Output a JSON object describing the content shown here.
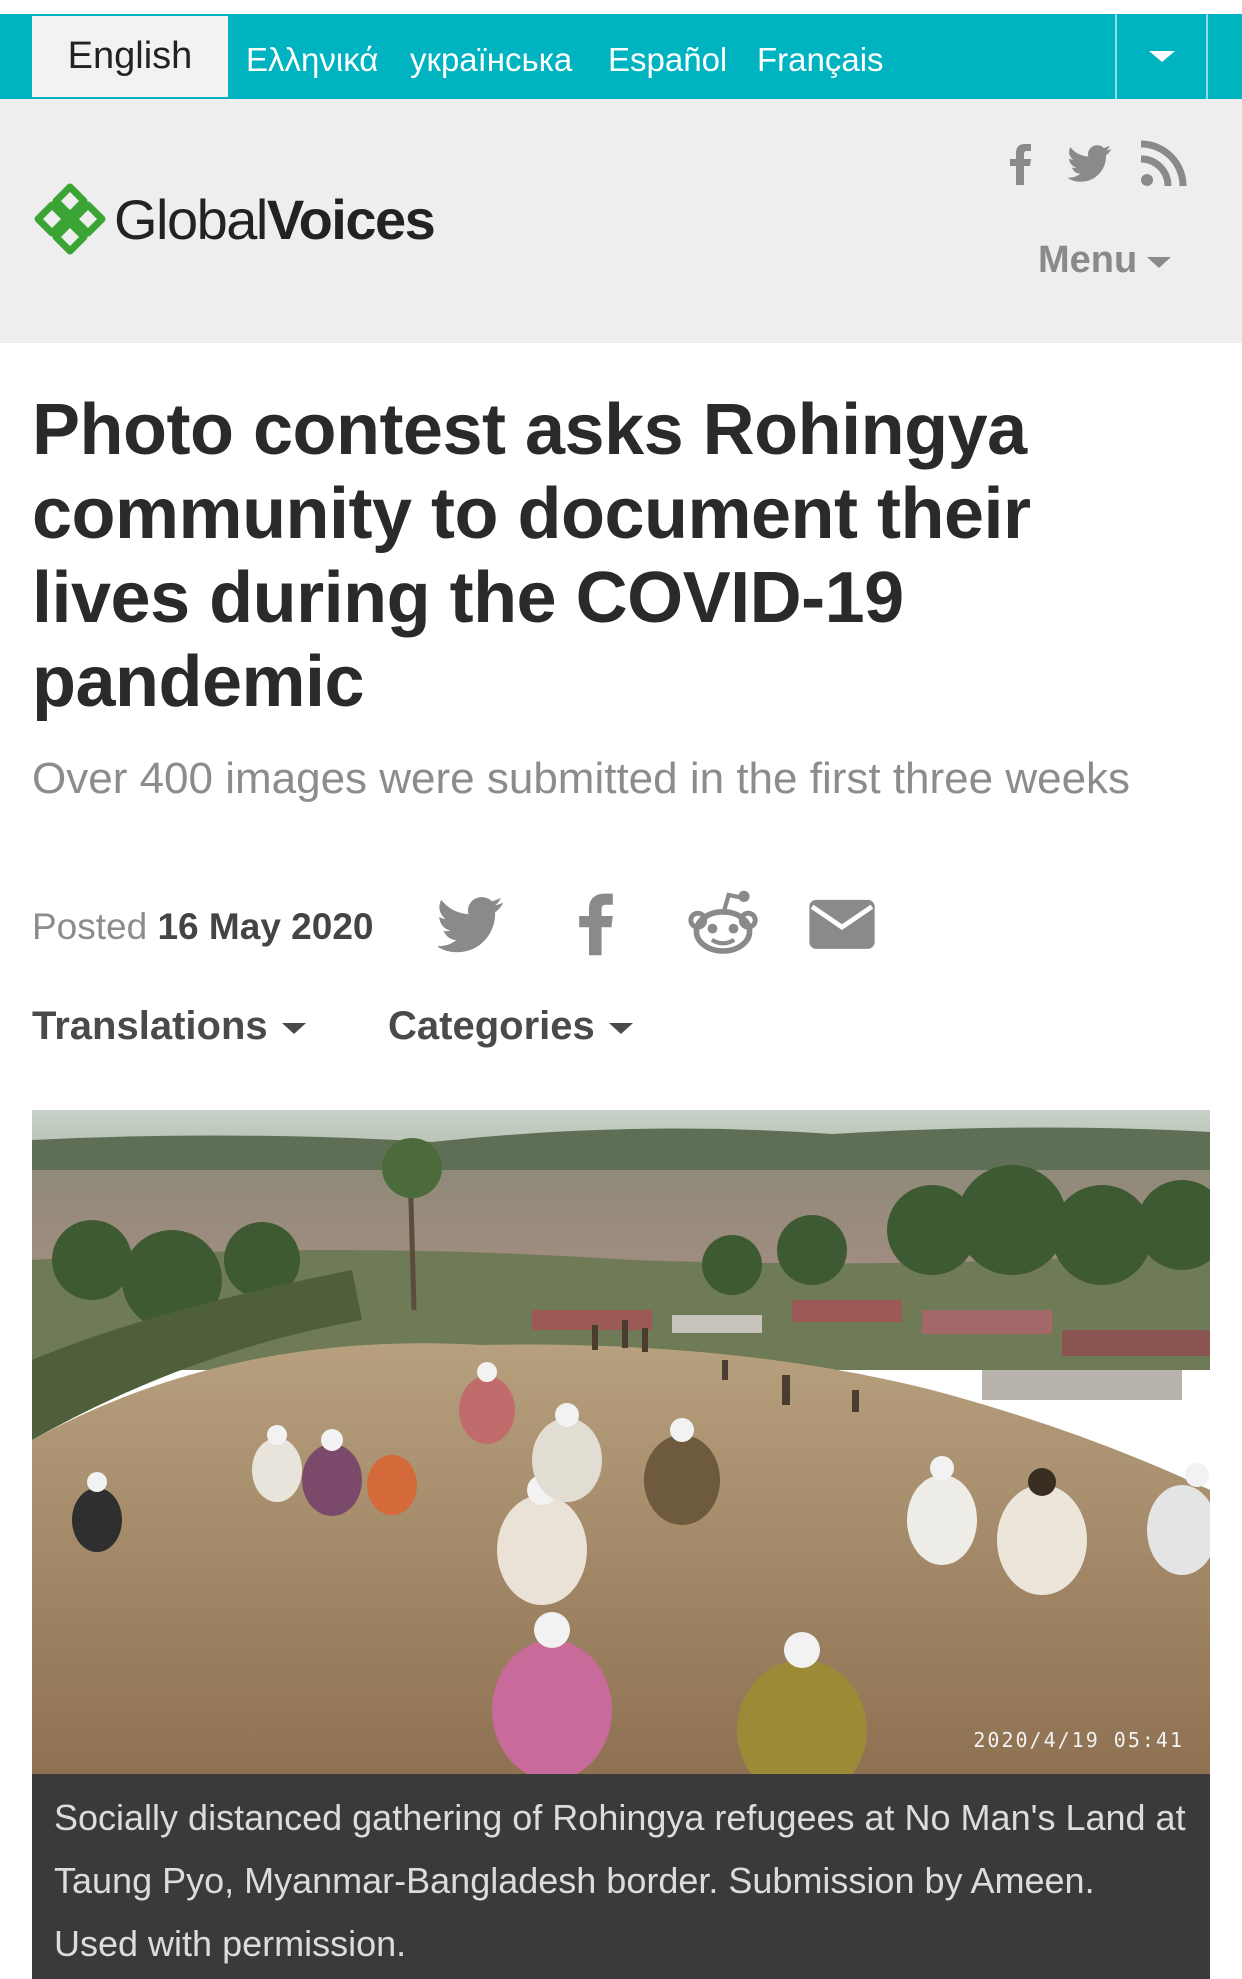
{
  "language_bar": {
    "active": "English",
    "languages": [
      "Ελληνικά",
      "українська",
      "Español",
      "Français"
    ]
  },
  "header": {
    "logo_light": "Global",
    "logo_bold": "Voices",
    "social_icons": [
      "facebook-icon",
      "twitter-icon",
      "rss-icon"
    ],
    "menu_label": "Menu"
  },
  "article": {
    "title": "Photo contest asks Rohingya community to document their lives during the COVID-19 pandemic",
    "subtitle": "Over 400 images were submitted in the first three weeks",
    "posted_label": "Posted",
    "posted_date": "16 May 2020",
    "share_icons": [
      "twitter-icon",
      "facebook-icon",
      "reddit-icon",
      "email-icon"
    ],
    "translations_label": "Translations",
    "categories_label": "Categories"
  },
  "photo": {
    "timestamp": "2020/4/19  05:41",
    "caption": "Socially distanced gathering of Rohingya refugees at No Man's Land at Taung Pyo, Myanmar-Bangladesh border. Submission by Ameen. Used with permission."
  },
  "colors": {
    "language_bar": "#00b3c1",
    "header_bg": "#eeeeee",
    "logo_green": "#3aa535",
    "caption_bg": "#3a3a3a"
  }
}
